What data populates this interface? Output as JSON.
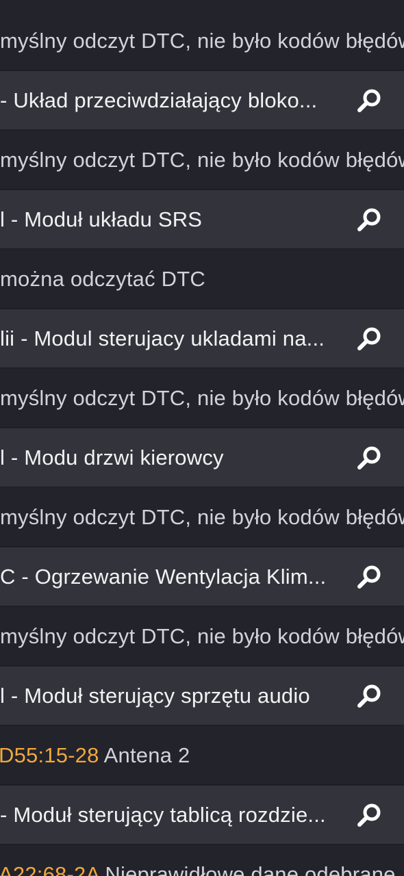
{
  "rows": [
    {
      "type": "status",
      "text": "myślny odczyt DTC, nie było kodów błędów"
    },
    {
      "type": "module",
      "text": "- Układ przeciwdziałający bloko...",
      "icon": "search-icon"
    },
    {
      "type": "status",
      "text": "myślny odczyt DTC, nie było kodów błędów"
    },
    {
      "type": "module",
      "text": "l - Moduł układu SRS",
      "icon": "search-icon"
    },
    {
      "type": "status",
      "text": " można odczytać DTC"
    },
    {
      "type": "module",
      "text": "lii - Modul sterujacy ukladami na...",
      "icon": "search-icon"
    },
    {
      "type": "status",
      "text": "myślny odczyt DTC, nie było kodów błędów"
    },
    {
      "type": "module",
      "text": "l - Modu drzwi kierowcy",
      "icon": "search-icon"
    },
    {
      "type": "status",
      "text": "myślny odczyt DTC, nie było kodów błędów"
    },
    {
      "type": "module",
      "text": "C - Ogrzewanie Wentylacja Klim...",
      "icon": "search-icon"
    },
    {
      "type": "status",
      "text": "myślny odczyt DTC, nie było kodów błędów"
    },
    {
      "type": "module",
      "text": "l - Moduł sterujący sprzętu audio",
      "icon": "search-icon"
    },
    {
      "type": "dtc",
      "code": "D55:15-28",
      "text": " Antena 2"
    },
    {
      "type": "module",
      "text": "- Moduł sterujący tablicą rozdzie...",
      "icon": "search-icon"
    },
    {
      "type": "dtc",
      "code": "A22:68-2A",
      "text": " Nieprawidłowe dane odebrane"
    }
  ],
  "colors": {
    "module_row": "#33333b",
    "status_row": "#23232b",
    "dtc_code": "#f2a93b",
    "text": "#f2f2f4"
  }
}
